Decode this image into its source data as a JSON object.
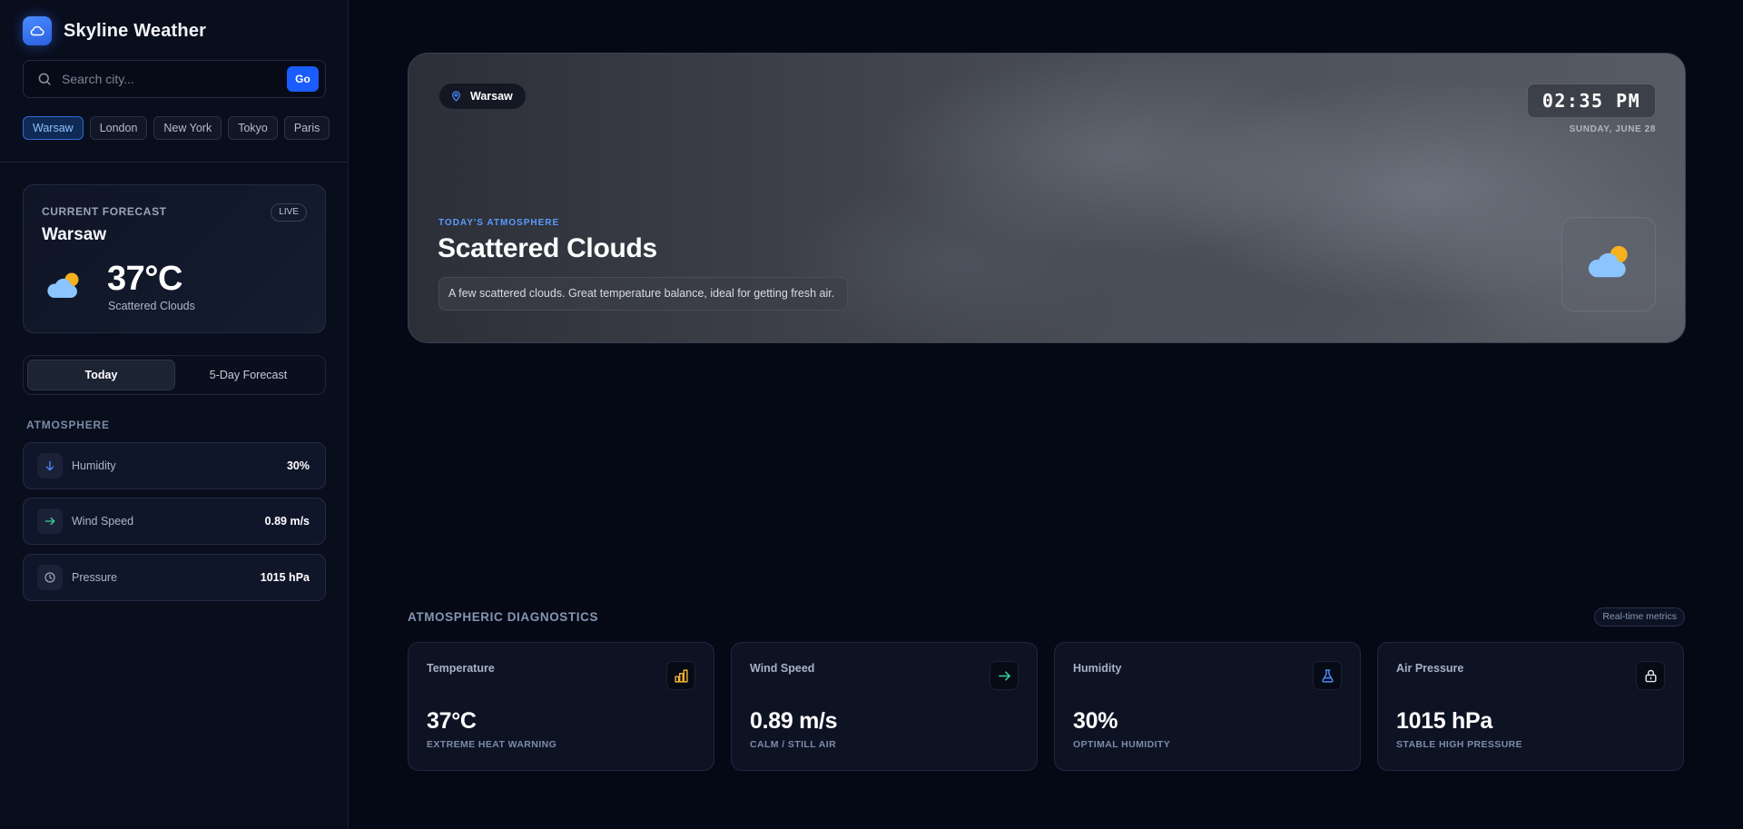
{
  "app": {
    "title": "Skyline Weather"
  },
  "search": {
    "placeholder": "Search city...",
    "value": "",
    "go_label": "Go"
  },
  "cities": [
    "Warsaw",
    "London",
    "New York",
    "Tokyo",
    "Paris"
  ],
  "active_city": "Warsaw",
  "current": {
    "label": "CURRENT FORECAST",
    "badge": "LIVE",
    "city": "Warsaw",
    "temp": "37°C",
    "desc": "Scattered Clouds",
    "icon": "partly-cloudy-icon"
  },
  "tabs": [
    {
      "label": "Today",
      "active": true
    },
    {
      "label": "5-Day Forecast",
      "active": false
    }
  ],
  "atmosphere": {
    "title": "ATMOSPHERE",
    "items": [
      {
        "label": "Humidity",
        "value": "30%",
        "icon": "arrow-down-icon",
        "color": "#4d8dff"
      },
      {
        "label": "Wind Speed",
        "value": "0.89 m/s",
        "icon": "arrow-right-icon",
        "color": "#34d399"
      },
      {
        "label": "Pressure",
        "value": "1015 hPa",
        "icon": "clock-icon",
        "color": "#9aa3b8"
      }
    ]
  },
  "hero": {
    "location": "Warsaw",
    "time": "02:35 PM",
    "date": "SUNDAY, JUNE 28",
    "kicker": "TODAY'S ATMOSPHERE",
    "title": "Scattered Clouds",
    "desc": "A few scattered clouds. Great temperature balance, ideal for getting fresh air.",
    "icon": "partly-cloudy-icon"
  },
  "diagnostics": {
    "title": "ATMOSPHERIC DIAGNOSTICS",
    "badge": "Real-time metrics",
    "cards": [
      {
        "label": "Temperature",
        "value": "37°C",
        "note": "EXTREME HEAT WARNING",
        "icon": "bar-chart-icon",
        "color": "#f5b52e"
      },
      {
        "label": "Wind Speed",
        "value": "0.89 m/s",
        "note": "CALM / STILL AIR",
        "icon": "arrow-right-icon",
        "color": "#34d399"
      },
      {
        "label": "Humidity",
        "value": "30%",
        "note": "OPTIMAL HUMIDITY",
        "icon": "flask-icon",
        "color": "#4d8dff"
      },
      {
        "label": "Air Pressure",
        "value": "1015 hPa",
        "note": "STABLE HIGH PRESSURE",
        "icon": "lock-icon",
        "color": "#e6e9f2"
      }
    ]
  },
  "colors": {
    "accent": "#1a5cff",
    "background": "#050815",
    "sidebar": "#090e1d"
  }
}
